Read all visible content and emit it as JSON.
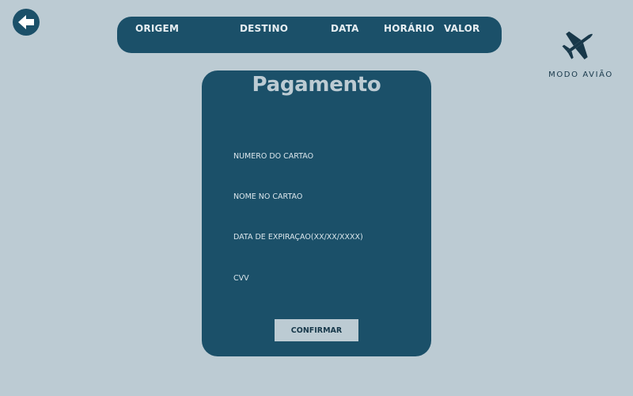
{
  "header": {
    "columns": [
      "ORIGEM",
      "DESTINO",
      "DATA",
      "HORÁRIO",
      "VALOR"
    ]
  },
  "brand": {
    "name": "MODO AVIÃO"
  },
  "payment": {
    "title": "Pagamento",
    "fields": {
      "card_number": {
        "placeholder": "NÚMERO DO CARTÃO",
        "value": ""
      },
      "card_name": {
        "placeholder": "NOME NO CARTÃO",
        "value": ""
      },
      "expiration": {
        "placeholder": "DATA DE EXPIRAÇÃO(XX/XX/XXXX)",
        "value": ""
      },
      "cvv": {
        "placeholder": "CVV",
        "value": ""
      }
    },
    "confirm_label": "CONFIRMAR"
  },
  "icons": {
    "back": "arrow-left-icon",
    "brand": "airplane-icon"
  },
  "colors": {
    "background": "#bccbd3",
    "primary": "#1b5069",
    "brand_text": "#18384a",
    "button_bg": "#bccbd3"
  }
}
